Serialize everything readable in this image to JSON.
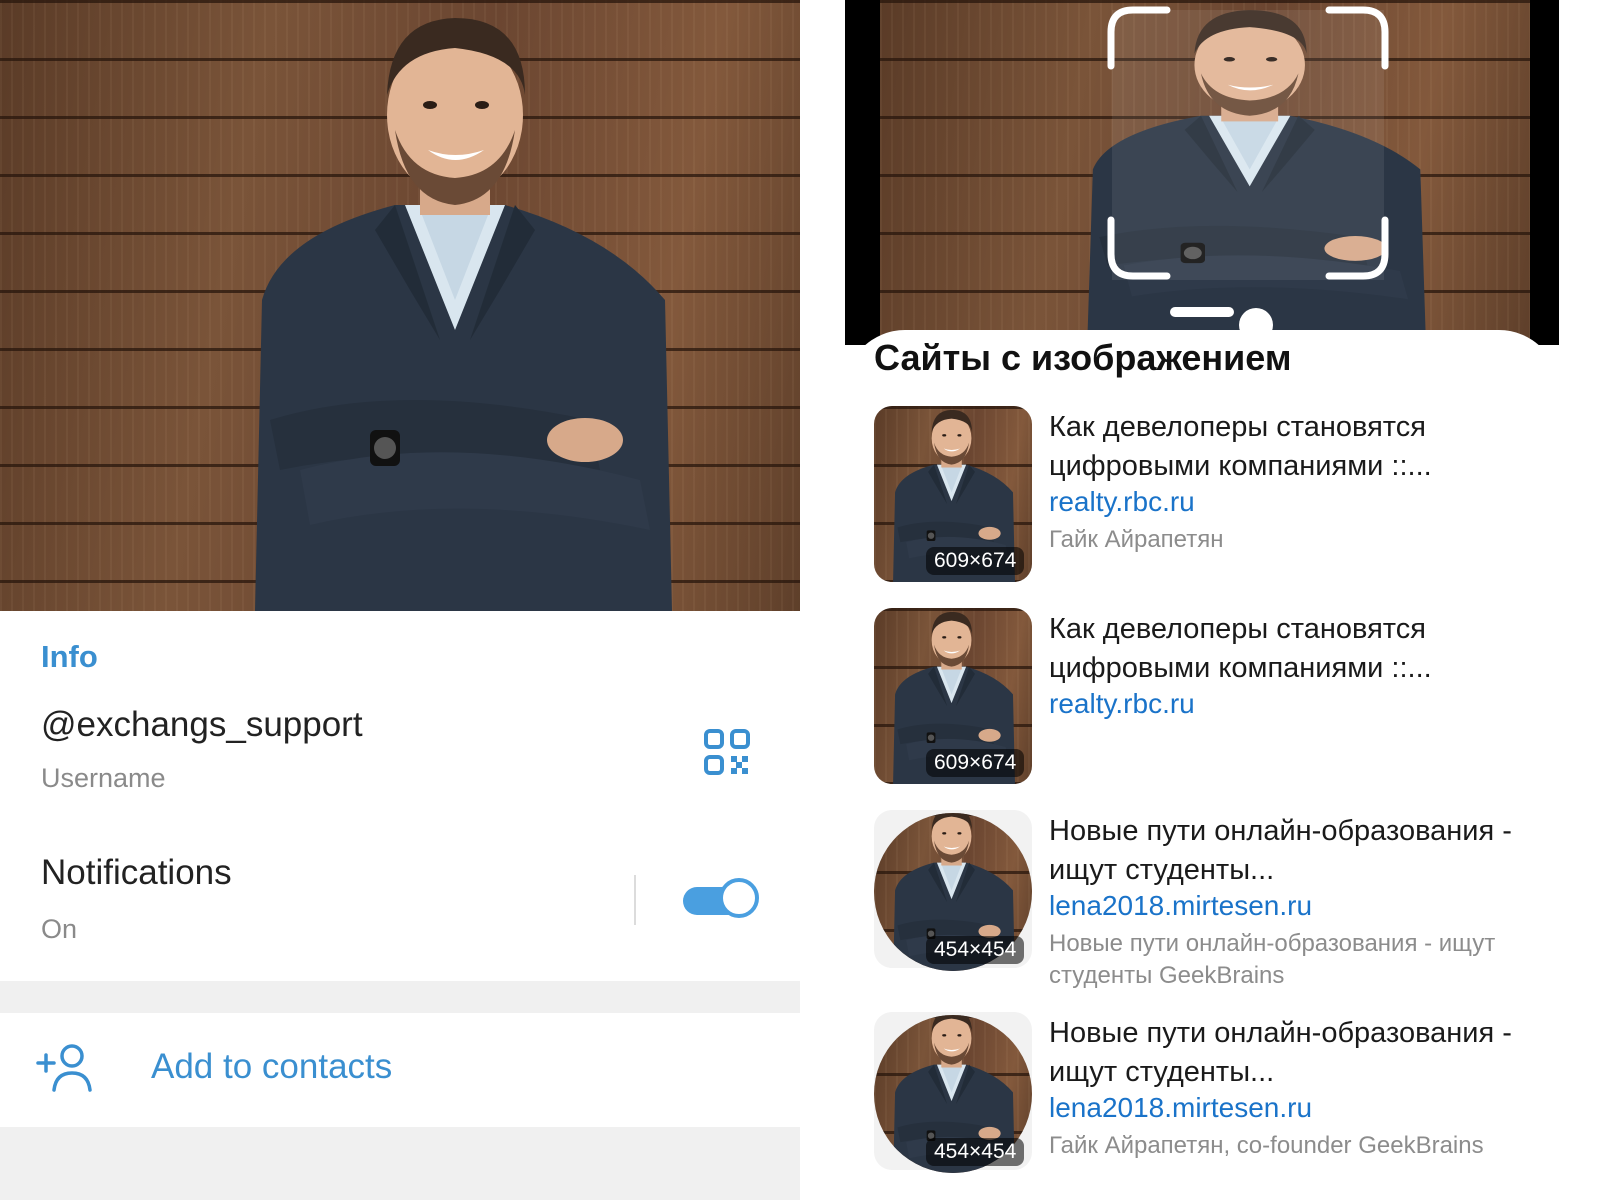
{
  "telegram_profile": {
    "info_title": "Info",
    "username": "@exchangs_support",
    "username_label": "Username",
    "notifications_label": "Notifications",
    "notifications_state": "On",
    "notifications_enabled": true,
    "add_contact_label": "Add to contacts",
    "icons": {
      "qr": "qr-code-icon",
      "add_contact": "add-person-icon"
    },
    "accent_color": "#3a8fd0"
  },
  "image_search": {
    "section_title": "Сайты с изображением",
    "results": [
      {
        "title": "Как девелоперы становятся цифровыми компаниями ::...",
        "link": "realty.rbc.ru",
        "description": "Гайк Айрапетян",
        "dims": "609×674",
        "shape": "square"
      },
      {
        "title": "Как девелоперы становятся цифровыми компаниями ::...",
        "link": "realty.rbc.ru",
        "description": "",
        "dims": "609×674",
        "shape": "square"
      },
      {
        "title": "Новые пути онлайн-образования - ищут студенты...",
        "link": "lena2018.mirtesen.ru",
        "description": "Новые пути онлайн-образования - ищут студенты GeekBrains",
        "dims": "454×454",
        "shape": "round"
      },
      {
        "title": "Новые пути онлайн-образования - ищут студенты...",
        "link": "lena2018.mirtesen.ru",
        "description": "Гайк Айрапетян, co-founder GeekBrains",
        "dims": "454×454",
        "shape": "round"
      }
    ],
    "link_color": "#1a73c9"
  }
}
